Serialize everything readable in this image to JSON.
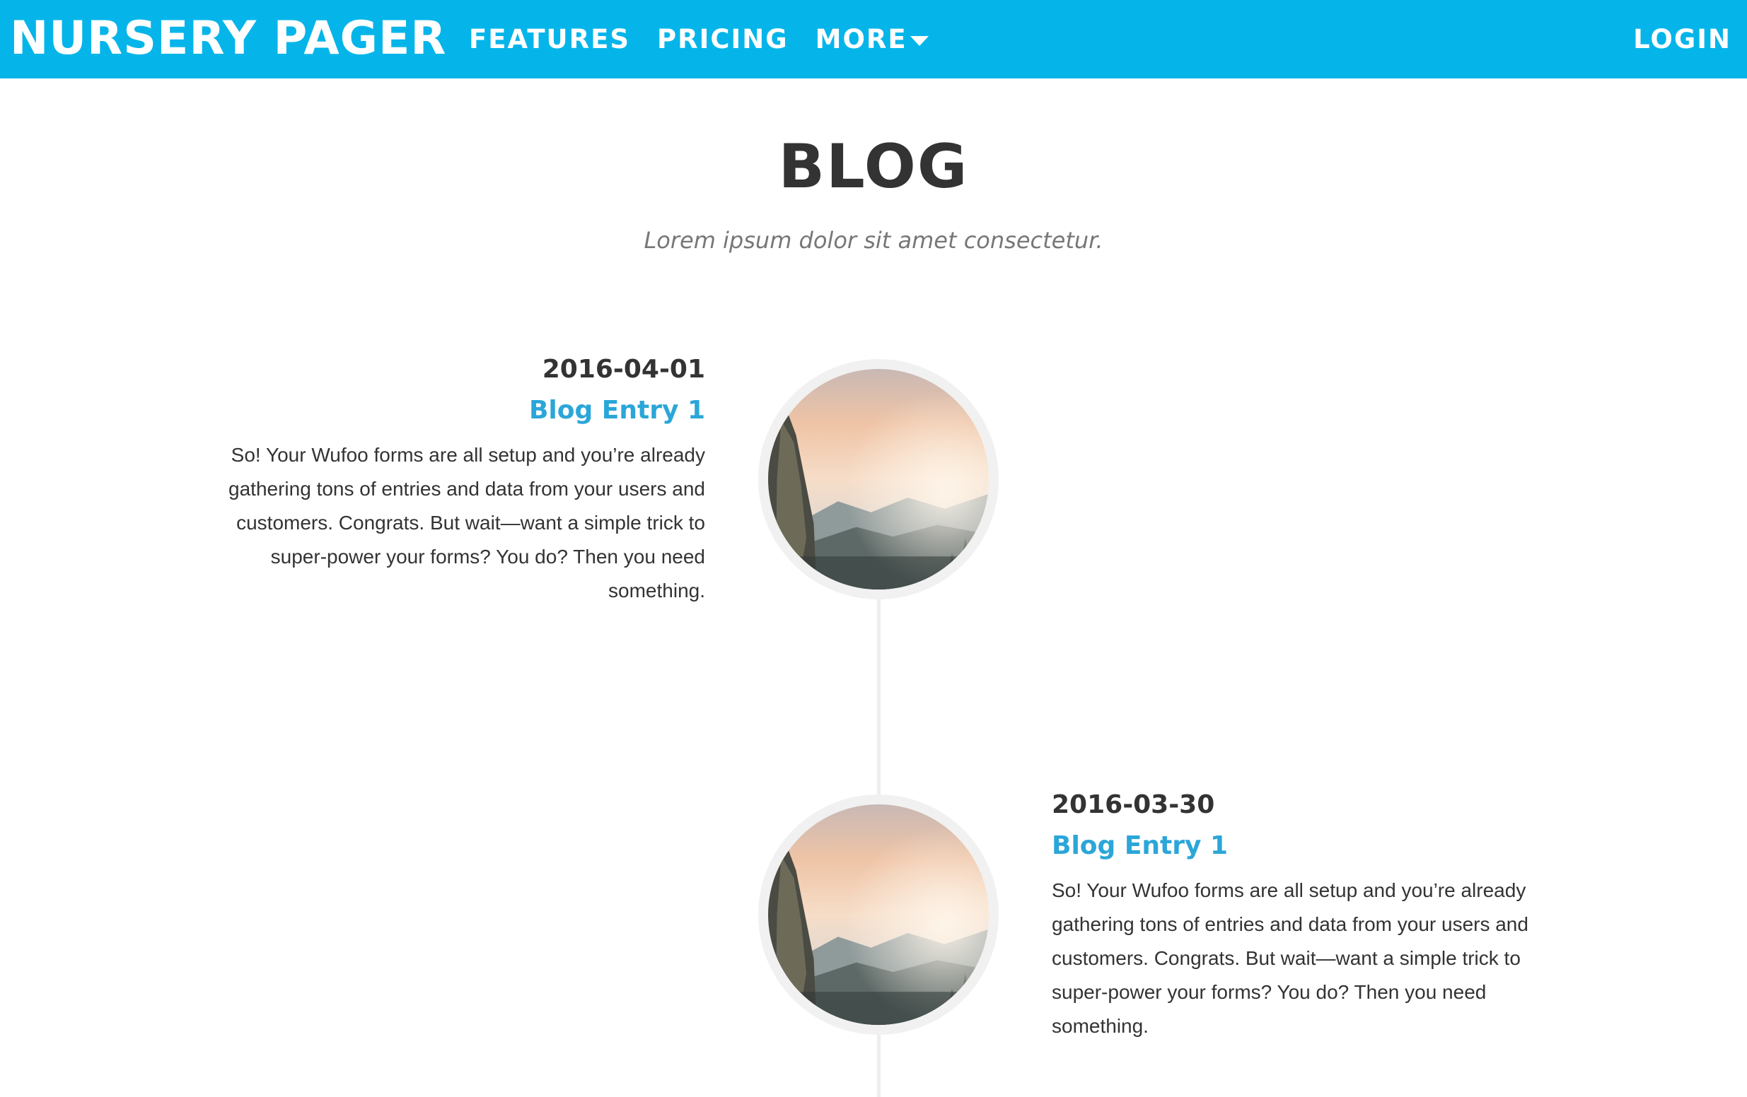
{
  "nav": {
    "brand": "NURSERY PAGER",
    "links": [
      "FEATURES",
      "PRICING",
      "MORE"
    ],
    "login": "LOGIN"
  },
  "header": {
    "title": "BLOG",
    "subtitle": "Lorem ipsum dolor sit amet consectetur."
  },
  "entries": [
    {
      "date": "2016-04-01",
      "title": "Blog Entry 1",
      "body": "So! Your Wufoo forms are all setup and you’re already gathering tons of entries and data from your users and customers. Congrats. But wait—want a simple trick to super-power your forms? You do? Then you need something."
    },
    {
      "date": "2016-03-30",
      "title": "Blog Entry 1",
      "body": "So! Your Wufoo forms are all setup and you’re already gathering tons of entries and data from your users and customers. Congrats. But wait—want a simple trick to super-power your forms? You do? Then you need something."
    }
  ],
  "colors": {
    "navbar": "#05b5e9",
    "link": "#2ba6d8",
    "text": "#333333",
    "muted": "#777777"
  },
  "icons": {
    "more_dropdown": "chevron-down-icon"
  }
}
